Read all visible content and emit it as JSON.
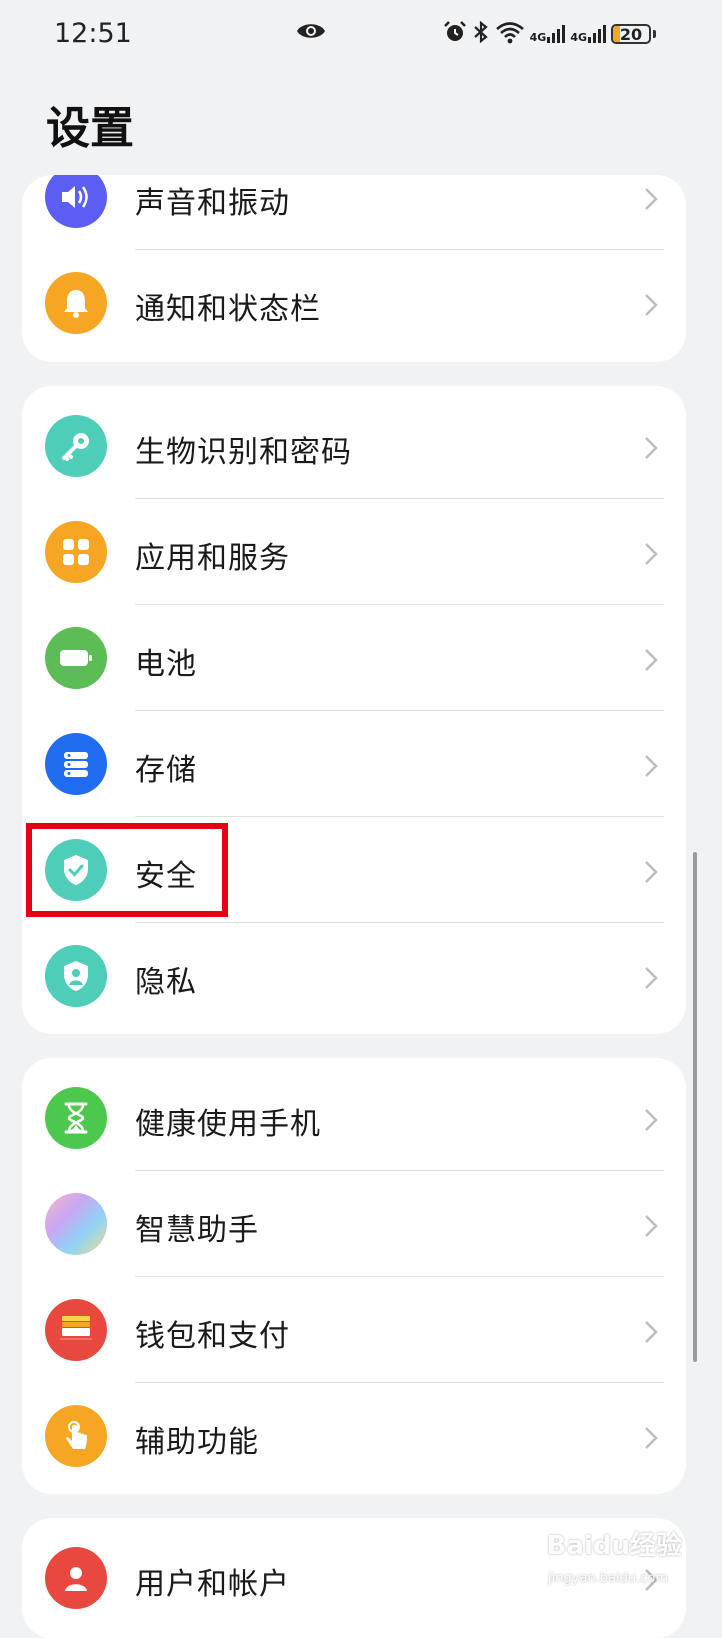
{
  "status_bar": {
    "time": "12:51",
    "net1": "4G",
    "net2": "4G",
    "battery_level": "20",
    "battery_color": "#f6a623"
  },
  "title": "设置",
  "groups": [
    {
      "items": [
        {
          "label": "声音和振动",
          "icon": "speaker-icon",
          "color": "#5b5ef2"
        },
        {
          "label": "通知和状态栏",
          "icon": "bell-icon",
          "color": "#f6a623"
        }
      ]
    },
    {
      "items": [
        {
          "label": "生物识别和密码",
          "icon": "key-icon",
          "color": "#4ecdb8"
        },
        {
          "label": "应用和服务",
          "icon": "apps-grid-icon",
          "color": "#f6a623"
        },
        {
          "label": "电池",
          "icon": "battery-icon",
          "color": "#5cbc56"
        },
        {
          "label": "存储",
          "icon": "storage-icon",
          "color": "#1f6cf0"
        },
        {
          "label": "安全",
          "icon": "shield-check-icon",
          "color": "#4ecdb8"
        },
        {
          "label": "隐私",
          "icon": "privacy-shield-icon",
          "color": "#4ecdb8"
        }
      ]
    },
    {
      "items": [
        {
          "label": "健康使用手机",
          "icon": "hourglass-icon",
          "color": "#4cc94c"
        },
        {
          "label": "智慧助手",
          "icon": "assistant-orb-icon",
          "color": "#e8a8d8"
        },
        {
          "label": "钱包和支付",
          "icon": "wallet-icon",
          "color": "#e9483e"
        },
        {
          "label": "辅助功能",
          "icon": "hand-touch-icon",
          "color": "#f6a623"
        }
      ]
    },
    {
      "items": [
        {
          "label": "用户和帐户",
          "icon": "user-icon",
          "color": "#e9483e"
        }
      ]
    }
  ],
  "highlight_color": "#e60012",
  "watermark": {
    "brand": "Baidu经验",
    "url": "jingyan.baidu.com"
  }
}
